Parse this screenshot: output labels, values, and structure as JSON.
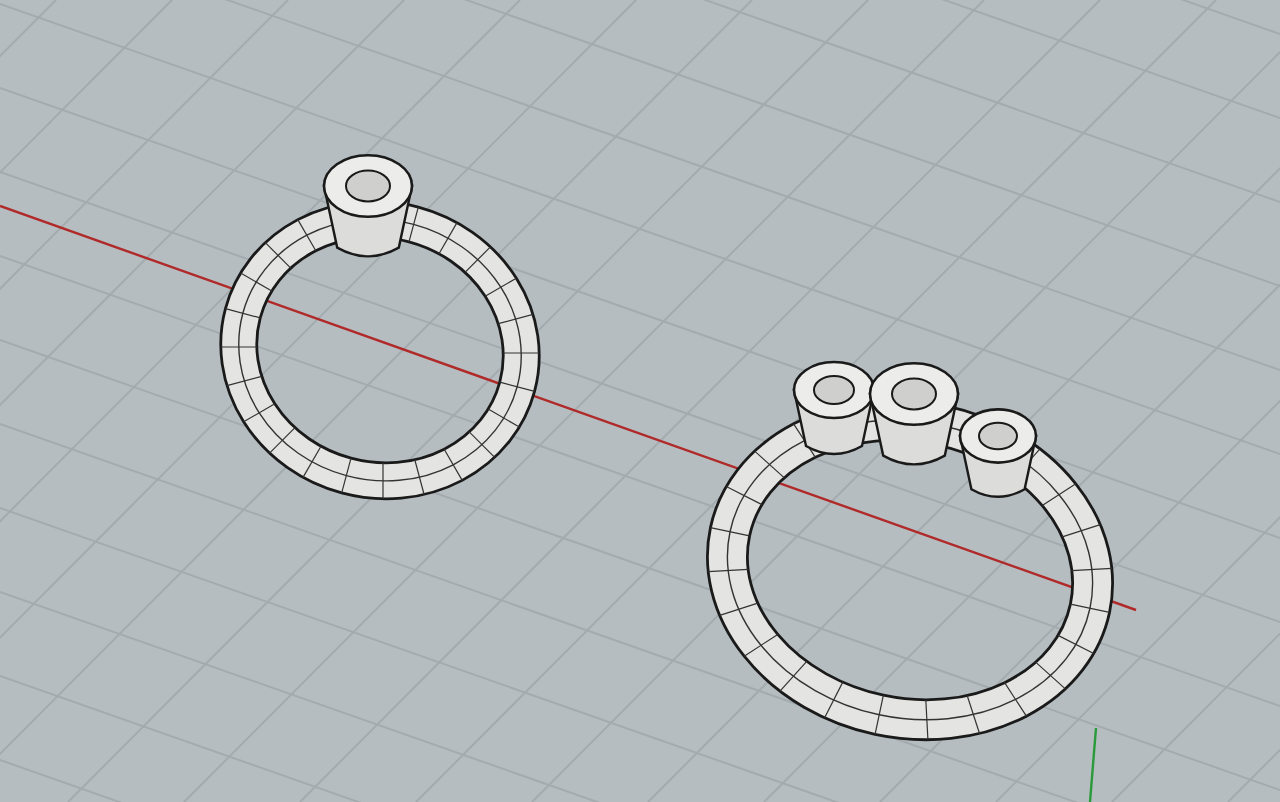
{
  "viewport": {
    "grid": true,
    "axes": true
  },
  "models": [
    {
      "kind": "solitaire"
    },
    {
      "kind": "three-stone"
    }
  ]
}
